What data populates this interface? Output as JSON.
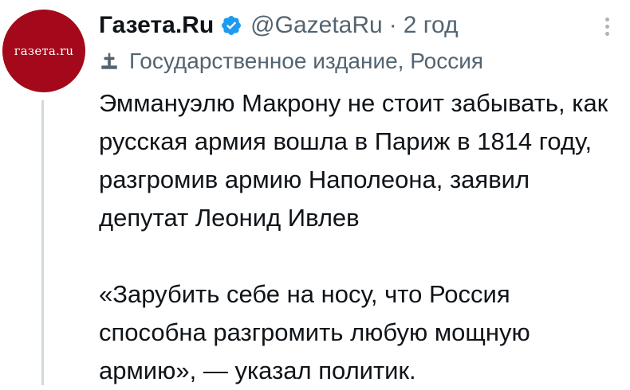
{
  "account": {
    "avatar_text": "газета.ru",
    "name": "Газета.Ru",
    "handle": "@GazetaRu",
    "separator": "·",
    "time": "2 год",
    "label": "Государственное издание, Россия"
  },
  "colors": {
    "avatar_bg": "#a3091b",
    "verified_blue": "#1d9bf0",
    "secondary_text": "#536471"
  },
  "icons": {
    "verified": "verified-badge-icon",
    "label": "gavel-icon",
    "more": "more-options-icon"
  },
  "tweet": {
    "paragraph_1": "Эммануэлю Макрону не стоит забывать, как русская армия вошла в Париж в 1814 году, разгромив армию Наполеона, заявил депутат Леонид Ивлев",
    "paragraph_2": "«Зарубить себе на носу, что Россия способна разгромить любую мощную армию», — указал политик."
  }
}
